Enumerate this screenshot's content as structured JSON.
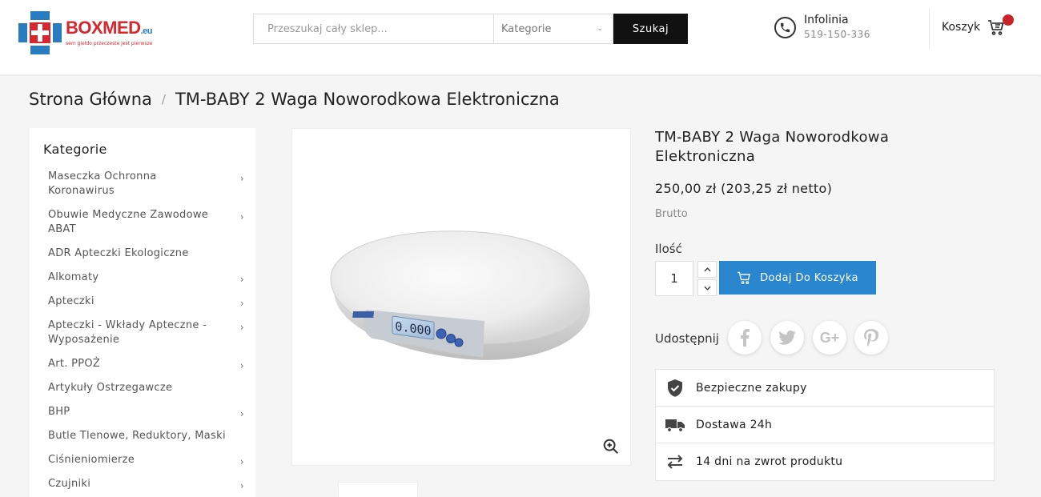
{
  "header": {
    "logo_name": "BOXMED",
    "logo_suffix": ".eu",
    "logo_tagline": "sem giełdo przeczeste jest pierwsze",
    "search_placeholder": "Przeszukaj cały sklep...",
    "category_select": "Kategorie",
    "search_button": "Szukaj",
    "hotline_title": "Infolinia",
    "hotline_number": "519-150-336",
    "cart_label": "Koszyk"
  },
  "breadcrumb": {
    "home": "Strona Główna",
    "separator": "/",
    "current": "TM-BABY 2 Waga Noworodkowa Elektroniczna"
  },
  "sidebar": {
    "title": "Kategorie",
    "items": [
      {
        "label": "Maseczka Ochronna Koronawirus",
        "has_children": true
      },
      {
        "label": "Obuwie Medyczne Zawodowe ABAT",
        "has_children": true
      },
      {
        "label": "ADR Apteczki Ekologiczne",
        "has_children": false
      },
      {
        "label": "Alkomaty",
        "has_children": true
      },
      {
        "label": "Apteczki",
        "has_children": true
      },
      {
        "label": "Apteczki - Wkłady Apteczne - Wyposażenie",
        "has_children": true
      },
      {
        "label": "Art. PPOŻ",
        "has_children": true
      },
      {
        "label": "Artykuły Ostrzegawcze",
        "has_children": false
      },
      {
        "label": "BHP",
        "has_children": true
      },
      {
        "label": "Butle Tlenowe, Reduktory, Maski",
        "has_children": false
      },
      {
        "label": "Ciśnieniomierze",
        "has_children": true
      },
      {
        "label": "Czujniki",
        "has_children": true
      }
    ]
  },
  "product": {
    "title": "TM-BABY 2 Waga Noworodkowa Elektroniczna",
    "price": "250,00 zł (203,25 zł netto)",
    "price_note": "Brutto",
    "quantity_label": "Ilość",
    "quantity_value": "1",
    "add_to_cart": "Dodaj Do Koszyka",
    "share_label": "Udostępnij",
    "share_networks": [
      "facebook-icon",
      "twitter-icon",
      "google-plus-icon",
      "pinterest-icon"
    ],
    "display_reading": "0.000",
    "benefits": [
      {
        "icon": "shield-check-icon",
        "label": "Bezpieczne zakupy"
      },
      {
        "icon": "truck-icon",
        "label": "Dostawa 24h"
      },
      {
        "icon": "exchange-arrows-icon",
        "label": "14 dni na zwrot produktu"
      }
    ]
  },
  "colors": {
    "brand_red": "#d9262e",
    "brand_blue": "#2a7cc1",
    "button_blue": "#2a86ce",
    "search_button_bg": "#111111",
    "cart_badge": "#c8222b"
  }
}
